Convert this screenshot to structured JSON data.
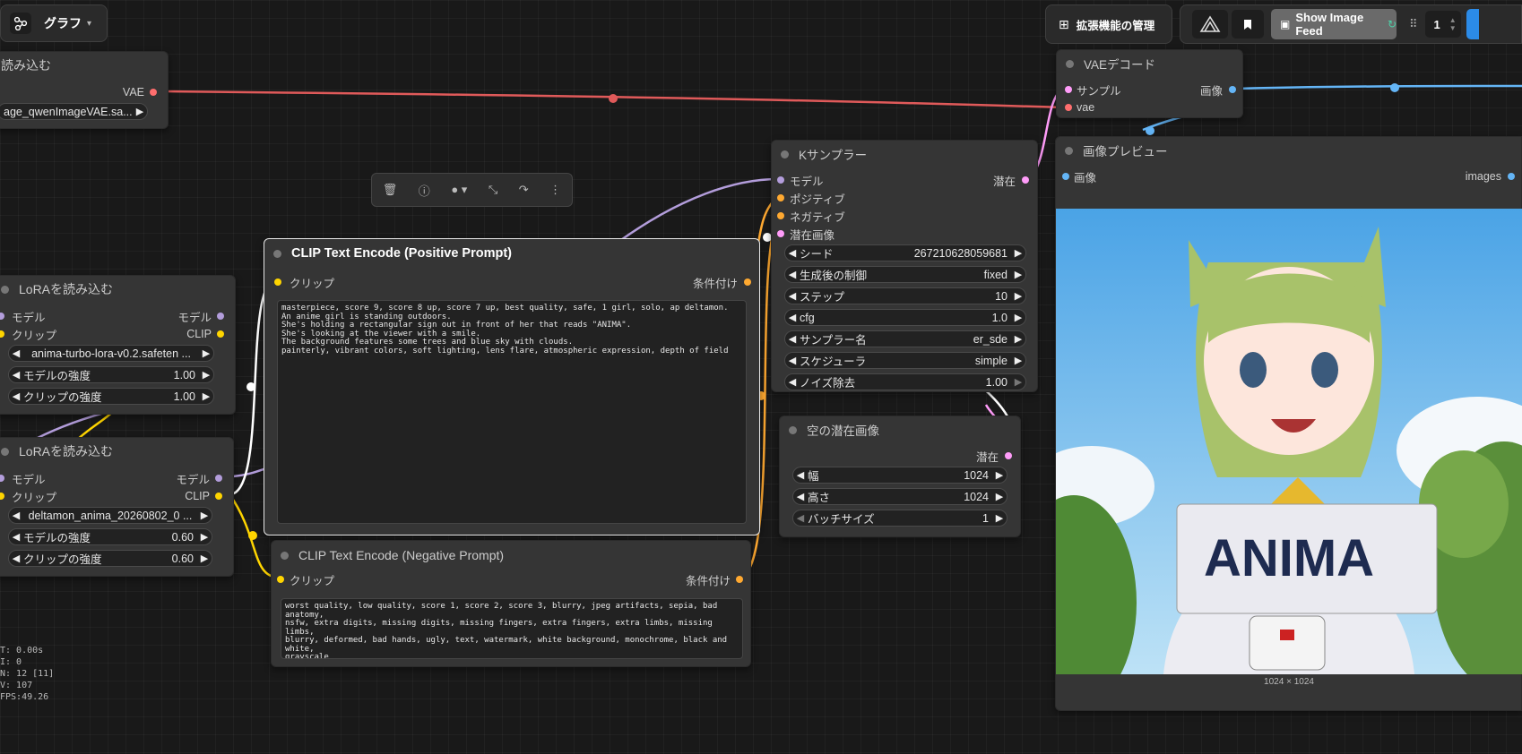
{
  "top": {
    "graph_label": "グラフ",
    "extensions_label": "拡張機能の管理",
    "image_feed_label": "Show Image Feed",
    "queue_count": "1"
  },
  "nodes": {
    "vae_loader": {
      "title": "読み込む",
      "out_vae": "VAE",
      "vae_name": "age_qwenImageVAE.sa..."
    },
    "lora1": {
      "title": "LoRAを読み込む",
      "in_model": "モデル",
      "in_clip": "クリップ",
      "out_model": "モデル",
      "out_clip": "CLIP",
      "lora_name": "anima-turbo-lora-v0.2.safeten ...",
      "strength_model_label": "モデルの強度",
      "strength_model": "1.00",
      "strength_clip_label": "クリップの強度",
      "strength_clip": "1.00"
    },
    "lora2": {
      "title": "LoRAを読み込む",
      "in_model": "モデル",
      "in_clip": "クリップ",
      "out_model": "モデル",
      "out_clip": "CLIP",
      "lora_name": "deltamon_anima_20260802_0 ...",
      "strength_model_label": "モデルの強度",
      "strength_model": "0.60",
      "strength_clip_label": "クリップの強度",
      "strength_clip": "0.60"
    },
    "clip_pos": {
      "title": "CLIP Text Encode (Positive Prompt)",
      "in_clip": "クリップ",
      "out_cond": "条件付け",
      "text": "masterpiece, score 9, score 8 up, score 7 up, best quality, safe, 1 girl, solo, ap deltamon.\nAn anime girl is standing outdoors.\nShe's holding a rectangular sign out in front of her that reads \"ANIMA\".\nShe's looking at the viewer with a smile.\nThe background features some trees and blue sky with clouds.\npainterly, vibrant colors, soft lighting, lens flare, atmospheric expression, depth of field"
    },
    "clip_neg": {
      "title": "CLIP Text Encode (Negative Prompt)",
      "in_clip": "クリップ",
      "out_cond": "条件付け",
      "text": "worst quality, low quality, score 1, score 2, score 3, blurry, jpeg artifacts, sepia, bad anatomy,\nnsfw, extra digits, missing digits, missing fingers, extra fingers, extra limbs, missing limbs,\nblurry, deformed, bad hands, ugly, text, watermark, white background, monochrome, black and white,\ngrayscale"
    },
    "ksampler": {
      "title": "Kサンプラー",
      "in_model": "モデル",
      "in_pos": "ポジティブ",
      "in_neg": "ネガティブ",
      "in_latent": "潜在画像",
      "out_latent": "潜在",
      "widgets": [
        {
          "label": "シード",
          "value": "267210628059681"
        },
        {
          "label": "生成後の制御",
          "value": "fixed"
        },
        {
          "label": "ステップ",
          "value": "10"
        },
        {
          "label": "cfg",
          "value": "1.0"
        },
        {
          "label": "サンプラー名",
          "value": "er_sde"
        },
        {
          "label": "スケジューラ",
          "value": "simple"
        },
        {
          "label": "ノイズ除去",
          "value": "1.00"
        }
      ]
    },
    "empty_latent": {
      "title": "空の潜在画像",
      "out_latent": "潜在",
      "widgets": [
        {
          "label": "幅",
          "value": "1024"
        },
        {
          "label": "高さ",
          "value": "1024"
        },
        {
          "label": "バッチサイズ",
          "value": "1"
        }
      ]
    },
    "vae_decode": {
      "title": "VAEデコード",
      "in_samples": "サンプル",
      "in_vae": "vae",
      "out_image": "画像"
    },
    "preview": {
      "title": "画像プレビュー",
      "in_images": "画像",
      "out_images": "images",
      "image_size": "1024 × 1024",
      "sign_text": "ANIMA"
    }
  },
  "stats": [
    "T: 0.00s",
    "I: 0",
    "N: 12 [11]",
    "V: 107",
    "FPS:49.26"
  ],
  "colors": {
    "model": "#b39ddb",
    "clip": "#ffd500",
    "vae": "#ff6e6e",
    "cond": "#ffa931",
    "latent": "#ff9cf9",
    "image": "#64b5f6"
  }
}
